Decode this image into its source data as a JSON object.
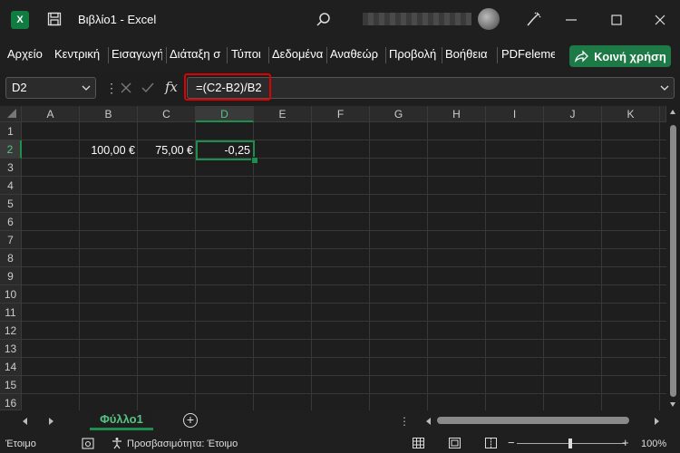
{
  "titlebar": {
    "app_icon_letter": "X",
    "title": "Βιβλίο1  -  Excel",
    "icons": [
      "excel-logo-icon",
      "save-icon",
      "search-icon",
      "brush-icon",
      "minimize-icon",
      "maximize-icon",
      "close-icon"
    ]
  },
  "ribbon": {
    "tabs": [
      "Αρχείο",
      "Κεντρική",
      "Εισαγωγή",
      "Διάταξη σ",
      "Τύποι",
      "Δεδομένα",
      "Αναθεώρ",
      "Προβολή",
      "Βοήθεια",
      "PDFeleme"
    ],
    "share_label": "Κοινή χρήση"
  },
  "formula_bar": {
    "name_box": "D2",
    "fx_label": "fx",
    "formula": "=(C2-B2)/B2"
  },
  "grid": {
    "columns": [
      "A",
      "B",
      "C",
      "D",
      "E",
      "F",
      "G",
      "H",
      "I",
      "J",
      "K"
    ],
    "rows": [
      "1",
      "2",
      "3",
      "4",
      "5",
      "6",
      "7",
      "8",
      "9",
      "10",
      "11",
      "12",
      "13",
      "14",
      "15",
      "16"
    ],
    "cells": {
      "B2": "100,00 €",
      "C2": "75,00 €",
      "D2": "-0,25"
    },
    "selected_cell": "D2"
  },
  "sheets": {
    "tabs": [
      "Φύλλο1"
    ],
    "add_label": "+"
  },
  "status": {
    "ready": "Έτοιμο",
    "accessibility": "Προσβασιμότητα: Έτοιμο",
    "zoom": "100%",
    "zoom_minus": "−",
    "zoom_plus": "+"
  },
  "colors": {
    "accent": "#1e8e4e",
    "share_button": "#1d7a46",
    "highlight_box": "#e00000"
  }
}
